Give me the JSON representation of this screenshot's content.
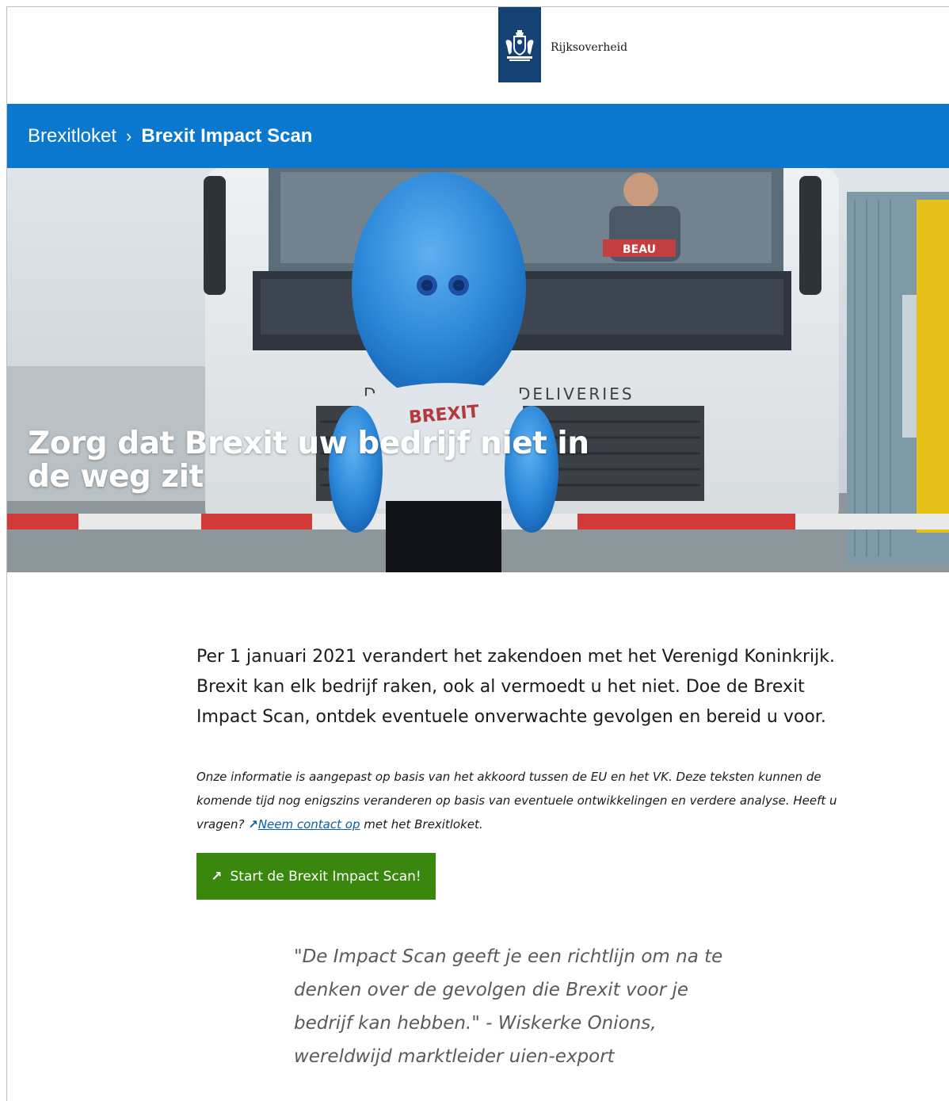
{
  "header": {
    "logo_text": "Rijksoverheid",
    "brand_color": "#154273"
  },
  "breadcrumb": {
    "home": "Brexitloket",
    "separator": "›",
    "current": "Brexit Impact Scan",
    "bar_color": "#0b78d0"
  },
  "hero": {
    "title": "Zorg dat Brexit uw bedrijf niet in de weg zit",
    "image_text_shirt": "BREXIT",
    "image_text_truck": "DELIVERIES",
    "image_text_plate": "BEAU",
    "image_text_truck_d": "D"
  },
  "main": {
    "intro": "Per 1 januari 2021 verandert het zakendoen met het Verenigd Koninkrijk. Brexit kan elk bedrijf raken, ook al vermoedt u het niet. Doe de Brexit Impact Scan, ontdek eventuele onverwachte gevolgen en bereid u voor.",
    "note_before": "Onze informatie is aangepast op basis van het akkoord tussen de EU en het VK. Deze teksten kunnen de komende tijd nog enigszins veranderen op basis van eventuele ontwikkelingen en verdere analyse. Heeft u vragen? ",
    "note_link": "Neem contact op",
    "note_after": " met het Brexitloket.",
    "start_button": "Start de Brexit Impact Scan!",
    "button_color": "#39870c",
    "quote": "\"De Impact Scan geeft je een richtlijn om na te denken over de gevolgen die Brexit voor je bedrijf kan hebben.\" - Wiskerke Onions, wereldwijd marktleider uien-export"
  }
}
